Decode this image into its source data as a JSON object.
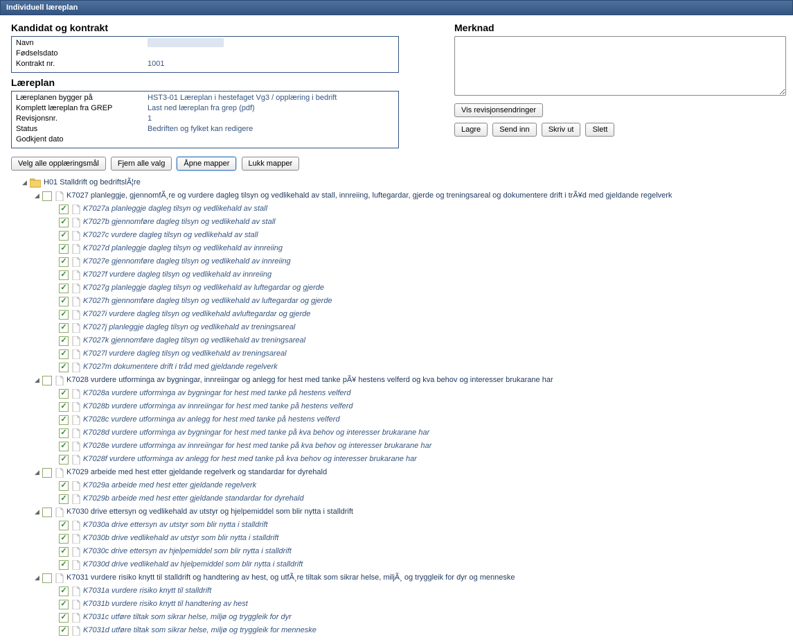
{
  "window_title": "Individuell læreplan",
  "sections": {
    "kandidat_title": "Kandidat og kontrakt",
    "laereplan_title": "Læreplan",
    "merknad_title": "Merknad"
  },
  "kandidat": {
    "navn_label": "Navn",
    "fodsel_label": "Fødselsdato",
    "kontrakt_label": "Kontrakt nr.",
    "kontrakt_value": "1001"
  },
  "laereplan": {
    "bygger_label": "Læreplanen bygger på",
    "bygger_value": "HST3-01 Læreplan i hestefaget Vg3 / opplæring i bedrift",
    "komplett_label": "Komplett læreplan fra GREP",
    "komplett_value": "Last ned læreplan fra grep (pdf)",
    "rev_label": "Revisjonsnr.",
    "rev_value": "1",
    "status_label": "Status",
    "status_value": "Bedriften og fylket kan redigere",
    "godkjent_label": "Godkjent dato"
  },
  "merknad": {
    "value": ""
  },
  "buttons": {
    "vis": "Vis revisjonsendringer",
    "lagre": "Lagre",
    "send_inn": "Send inn",
    "skriv_ut": "Skriv ut",
    "slett": "Slett",
    "velg_alle": "Velg alle opplæringsmål",
    "fjern_alle": "Fjern alle valg",
    "apne": "Åpne mapper",
    "lukk": "Lukk mapper"
  },
  "tree": {
    "root": {
      "label": "H01 Stalldrift og bedriftslÃ¦re"
    },
    "k7027": {
      "label": "K7027 planleggje, gjennomfÃ¸re og vurdere dagleg tilsyn og vedlikehald av stall, innreiing, luftegardar, gjerde og treningsareal og dokumentere drift i trÃ¥d med gjeldande regelverk",
      "children": [
        "K7027a planleggje dagleg tilsyn og vedlikehald av stall",
        "K7027b gjennomføre dagleg tilsyn og vedlikehald av stall",
        "K7027c vurdere dagleg tilsyn og vedlikehald av stall",
        "K7027d planleggje dagleg tilsyn og vedlikehald av innreiing",
        "K7027e gjennomføre dagleg tilsyn og vedlikehald av innreiing",
        "K7027f vurdere dagleg tilsyn og vedlikehald av innreiing",
        "K7027g planleggje dagleg tilsyn og vedlikehald av luftegardar og gjerde",
        "K7027h gjennomføre dagleg tilsyn og vedlikehald av luftegardar og gjerde",
        "K7027i vurdere dagleg tilsyn og vedlikehald avluftegardar og gjerde",
        "K7027j planleggje dagleg tilsyn og vedlikehald av treningsareal",
        "K7027k gjennomføre dagleg tilsyn og vedlikehald av treningsareal",
        "K7027l vurdere dagleg tilsyn og vedlikehald av treningsareal",
        "K7027m dokumentere drift i tråd med gjeldande regelverk"
      ]
    },
    "k7028": {
      "label": "K7028 vurdere utforminga av bygningar, innreiingar og anlegg for hest med tanke pÃ¥ hestens velferd og kva behov og interesser brukarane har",
      "children": [
        "K7028a vurdere utforminga av bygningar for hest med tanke på hestens velferd",
        "K7028b vurdere utforminga av innreiingar for hest med tanke på hestens velferd",
        "K7028c vurdere utforminga av anlegg for hest med tanke på hestens velferd",
        "K7028d vurdere utforminga av bygningar for hest med tanke på kva behov og interesser brukarane har",
        "K7028e vurdere utforminga av innreiingar for hest med tanke på kva behov og interesser brukarane har",
        "K7028f vurdere utforminga av anlegg for hest med tanke på kva behov og interesser brukarane har"
      ]
    },
    "k7029": {
      "label": "K7029 arbeide med hest etter gjeldande regelverk og standardar for dyrehald",
      "children": [
        "K7029a arbeide med hest etter gjeldande regelverk",
        "K7029b arbeide med hest etter gjeldande standardar for dyrehald"
      ]
    },
    "k7030": {
      "label": "K7030 drive ettersyn og vedlikehald av utstyr og hjelpemiddel som blir nytta i stalldrift",
      "children": [
        "K7030a drive ettersyn av utstyr som blir nytta i stalldrift",
        "K7030b drive vedlikehald av utstyr som blir nytta i stalldrift",
        "K7030c drive ettersyn av hjelpemiddel som blir nytta i stalldrift",
        "K7030d drive vedlikehald av hjelpemiddel som blir nytta i stalldrift"
      ]
    },
    "k7031": {
      "label": "K7031 vurdere risiko knytt til stalldrift og handtering av hest, og utfÃ¸re tiltak som sikrar helse, miljÃ¸ og tryggleik for dyr og menneske",
      "children": [
        "K7031a vurdere risiko knytt til stalldrift",
        "K7031b vurdere risiko knytt til handtering av hest",
        "K7031c utføre tiltak som sikrar helse, miljø og tryggleik for dyr",
        "K7031d utføre tiltak som sikrar helse, miljø og tryggleik for menneske"
      ]
    }
  }
}
